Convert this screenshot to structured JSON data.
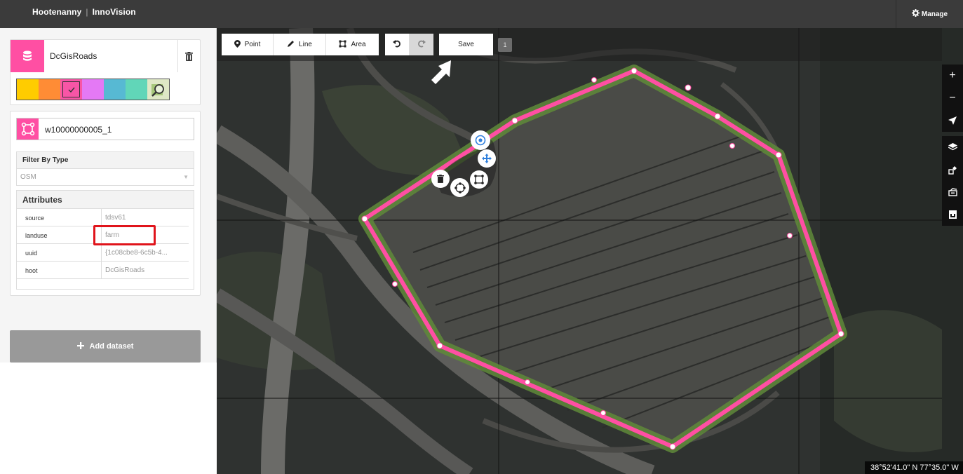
{
  "app": {
    "brand_left": "Hootenanny",
    "brand_sep": "|",
    "brand_right": "InnoVision",
    "manage_label": "Manage"
  },
  "dataset": {
    "name": "DcGisRoads",
    "palette": [
      "#ffcc00",
      "#ff8c35",
      "#f855a6",
      "#e479f5",
      "#57b9d3",
      "#61d6b8"
    ],
    "selected_swatch": 2
  },
  "feature": {
    "id": "w10000000005_1",
    "filter_label": "Filter By Type",
    "filter_value": "OSM",
    "attributes_label": "Attributes",
    "attributes": [
      {
        "key": "source",
        "value": "tdsv61"
      },
      {
        "key": "landuse",
        "value": "farm"
      },
      {
        "key": "uuid",
        "value": "{1c08cbe8-6c5b-4..."
      },
      {
        "key": "hoot",
        "value": "DcGisRoads"
      }
    ]
  },
  "add_dataset_label": "Add dataset",
  "toolbar": {
    "point_label": "Point",
    "line_label": "Line",
    "area_label": "Area",
    "save_label": "Save",
    "edit_count": "1"
  },
  "map": {
    "coordinates": "38°52'41.0\" N 77°35.0\" W",
    "area_color": "#ff4fa3",
    "area_fill": "#5f8a3a"
  }
}
